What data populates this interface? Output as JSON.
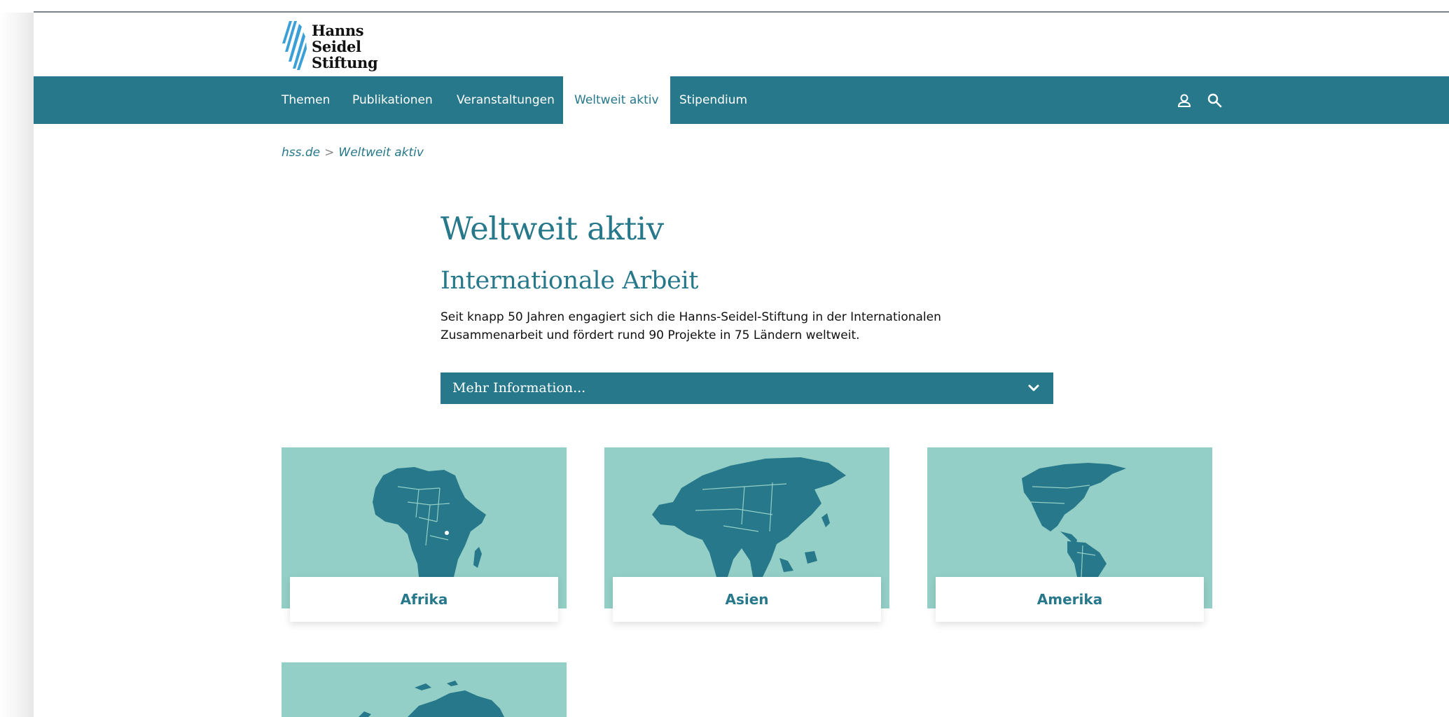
{
  "logo": {
    "line1": "Hanns",
    "line2": "Seidel",
    "line3": "Stiftung"
  },
  "nav": {
    "items": [
      {
        "label": "Themen"
      },
      {
        "label": "Publikationen"
      },
      {
        "label": "Veranstaltungen"
      },
      {
        "label": "Weltweit aktiv",
        "active": true
      },
      {
        "label": "Stipendium"
      }
    ],
    "icons": [
      "user-icon",
      "search-icon"
    ]
  },
  "breadcrumb": {
    "home": "hss.de",
    "separator": ">",
    "current": "Weltweit aktiv"
  },
  "main": {
    "title": "Weltweit aktiv",
    "subtitle": "Internationale Arbeit",
    "intro_line1": "Seit knapp 50 Jahren engagiert sich die Hanns-Seidel-Stiftung in der Internationalen",
    "intro_line2": "Zusammenarbeit und fördert rund 90 Projekte in 75 Ländern weltweit.",
    "accordion_label": "Mehr Information..."
  },
  "regions": [
    {
      "label": "Afrika"
    },
    {
      "label": "Asien"
    },
    {
      "label": "Amerika"
    }
  ],
  "colors": {
    "brand": "#27788a",
    "card_bg": "#93cfc6",
    "map_fill": "#27788a"
  }
}
